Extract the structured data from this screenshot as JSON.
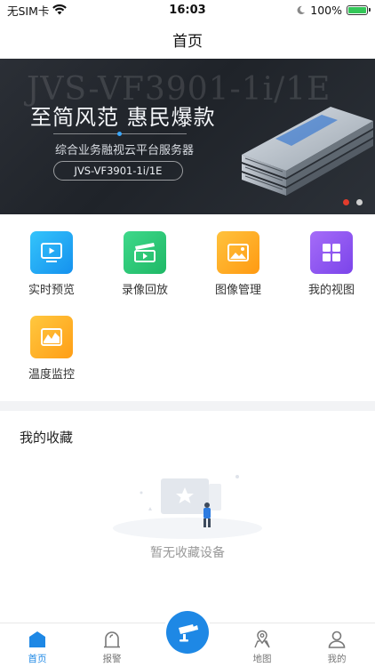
{
  "status_bar": {
    "carrier": "无SIM卡",
    "time": "16:03",
    "battery": "100%",
    "battery_level": 1.0
  },
  "nav": {
    "title": "首页"
  },
  "banner": {
    "watermark": "JVS-VF3901-1i/1E",
    "headline": "至简风范 惠民爆款",
    "subtitle": "综合业务融视云平台服务器",
    "model": "JVS-VF3901-1i/1E",
    "slide_count": 2,
    "active_slide": 1
  },
  "functions": [
    {
      "label": "实时预览",
      "icon": "live-preview-icon",
      "color": "#1fa8f3"
    },
    {
      "label": "录像回放",
      "icon": "playback-icon",
      "color": "#2fc978"
    },
    {
      "label": "图像管理",
      "icon": "image-manage-icon",
      "color": "#ffa81f"
    },
    {
      "label": "我的视图",
      "icon": "my-view-icon",
      "color": "#8e57f2"
    },
    {
      "label": "温度监控",
      "icon": "temperature-icon",
      "color": "#ffab1d"
    }
  ],
  "favorites": {
    "title": "我的收藏",
    "empty_text": "暂无收藏设备"
  },
  "tab_bar": {
    "tabs": [
      {
        "label": "首页",
        "icon": "home-icon",
        "active": true
      },
      {
        "label": "报警",
        "icon": "alarm-icon",
        "active": false
      },
      {
        "label": "",
        "icon": "camera-icon",
        "active": false
      },
      {
        "label": "地图",
        "icon": "map-icon",
        "active": false
      },
      {
        "label": "我的",
        "icon": "profile-icon",
        "active": false
      }
    ]
  },
  "colors": {
    "accent": "#1e88e5",
    "banner_dot_active": "#e23c2c"
  }
}
